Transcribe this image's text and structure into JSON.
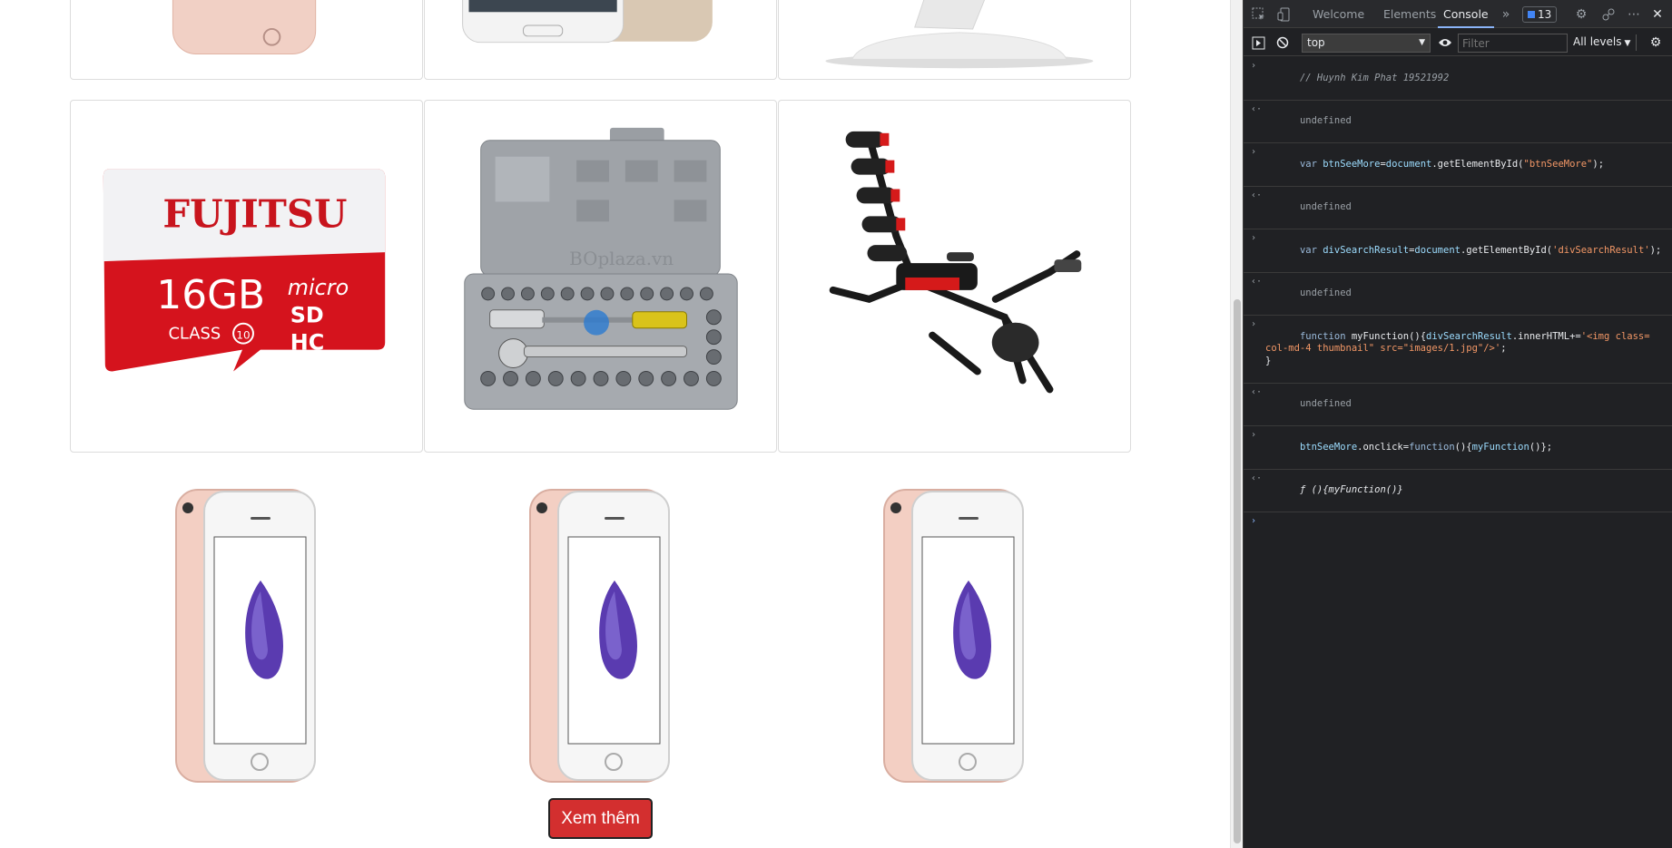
{
  "page": {
    "see_more_label": "Xem thêm",
    "products_row1": [
      "iphone-product",
      "samsung-phone-product",
      "stand-product"
    ],
    "products_row2": [
      "fujitsu-microsd-product",
      "socket-wrench-set-product",
      "fitness-machine-product"
    ],
    "products_row3": [
      "iphone-rose-gold",
      "iphone-rose-gold",
      "iphone-rose-gold"
    ],
    "microsd": {
      "brand": "FUJITSU",
      "capacity": "16GB",
      "class_label": "CLASS",
      "class_num": "10",
      "micro": "micro",
      "sd": "SD",
      "hc": "HC"
    },
    "watermark": "BOplaza.vn"
  },
  "devtools": {
    "tabs": [
      "Welcome",
      "Elements",
      "Console"
    ],
    "active_tab": "Console",
    "issues_count": "13",
    "context": "top",
    "filter_placeholder": "Filter",
    "levels": "All levels",
    "console": {
      "comment": "// Huynh Kim Phat 19521992",
      "undefined": "undefined",
      "line1_kw": "var ",
      "line1_var": "btnSeeMore",
      "line1_eq": "=",
      "line1_doc": "document",
      "line1_method": ".getElementById(",
      "line1_str": "\"btnSeeMore\"",
      "line1_end": ");",
      "line2_var": "divSearchResult",
      "line2_str": "'divSearchResult'",
      "line3_kw": "function ",
      "line3_name": "myFunction",
      "line3_open": "(){",
      "line3_target": "divSearchResult",
      "line3_prop": ".innerHTML+=",
      "line3_str": "'<img class=\ncol-md-4 thumbnail\" src=\"images/1.jpg\"/>'",
      "line3_semi": ";",
      "line3_close": "}",
      "line4_obj": "btnSeeMore",
      "line4_prop": ".onclick=",
      "line4_kw": "function",
      "line4_body_open": "(){",
      "line4_call": "myFunction",
      "line4_body_close": "()};",
      "result_f": "ƒ ",
      "result_body": "(){myFunction()}"
    }
  },
  "colors": {
    "button_red": "#d32f2f",
    "devtools_bg": "#202124",
    "devtools_accent": "#8ab4f8",
    "string_color": "#f29766"
  }
}
